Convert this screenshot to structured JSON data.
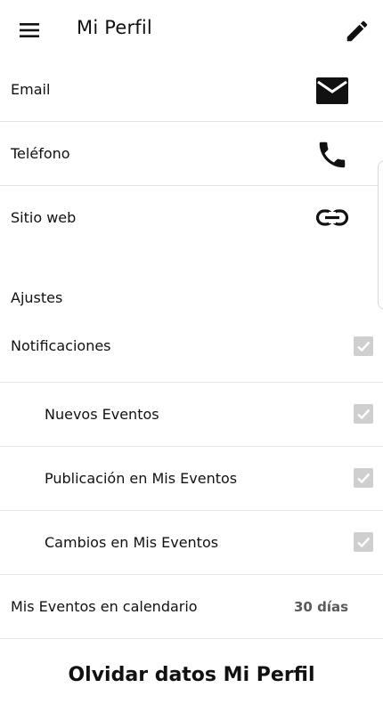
{
  "appbar": {
    "title": "Mi Perfil",
    "menu_icon": "menu-icon",
    "edit_icon": "pencil-icon"
  },
  "contact": [
    {
      "label": "Email",
      "icon": "email-icon"
    },
    {
      "label": "Teléfono",
      "icon": "phone-icon"
    },
    {
      "label": "Sitio web",
      "icon": "link-icon"
    }
  ],
  "settings": {
    "title": "Ajustes",
    "notifications": {
      "label": "Notificaciones",
      "checked": true
    },
    "options": [
      {
        "label": "Nuevos Eventos",
        "checked": true
      },
      {
        "label": "Publicación en Mis Eventos",
        "checked": true
      },
      {
        "label": "Cambios en Mis Eventos",
        "checked": true
      }
    ],
    "calendar": {
      "label": "Mis Eventos en calendario",
      "value": "30 días"
    }
  },
  "actions": {
    "forget_label": "Olvidar datos Mi Perfil"
  },
  "colors": {
    "text": "#111111",
    "checkbox_disabled": "#cfcfcf",
    "divider": "#e4e4e4"
  }
}
